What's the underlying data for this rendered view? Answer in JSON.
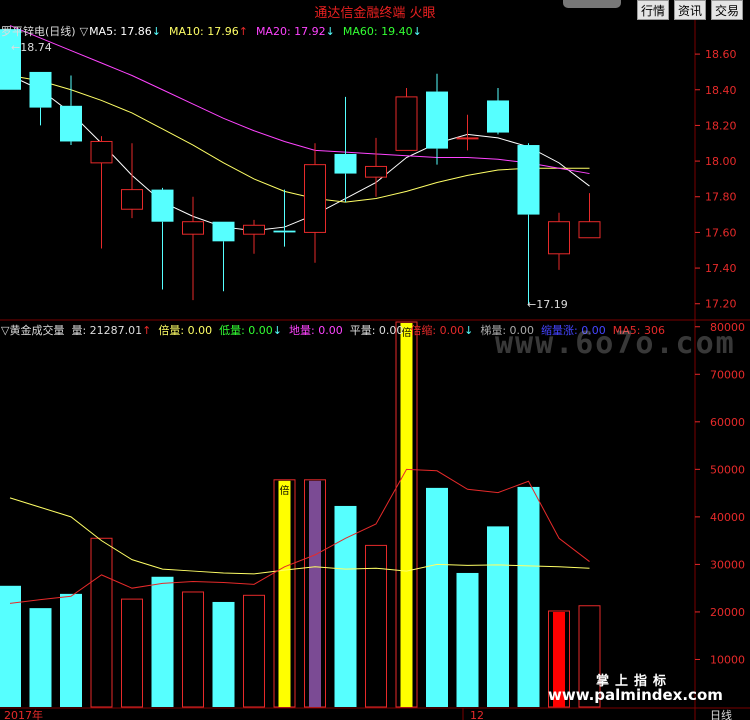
{
  "header": {
    "app_title": "通达信金融终端  火眼",
    "buttons": [
      {
        "label": "行情",
        "left": 637
      },
      {
        "label": "资讯",
        "left": 674
      },
      {
        "label": "交易",
        "left": 711
      }
    ]
  },
  "colors": {
    "up": "#e62a2a",
    "down": "#56ffff",
    "ma5": "#ffffff",
    "ma10": "#ffff66",
    "ma20": "#ff44ff",
    "ma60": "#33ff33",
    "grid": "#7a0000",
    "vol_ma5": "#ffff66",
    "vol_ma10": "#e62a2a",
    "yellow_bar": "#ffff00",
    "purple_bar": "#7b4b94",
    "solid_red": "#ff0000",
    "axis_text": "#e62a2a"
  },
  "price_panel": {
    "stock": "罗平锌电(日线)",
    "marker": "▽",
    "ma_labels": [
      {
        "text": "MA5: 17.86",
        "arrow": "↓",
        "color": "#ffffff"
      },
      {
        "text": "MA10: 17.96",
        "arrow": "↑",
        "color": "#ffff66"
      },
      {
        "text": "MA20: 17.92",
        "arrow": "↓",
        "color": "#ff44ff"
      },
      {
        "text": "MA60: 19.40",
        "arrow": "↓",
        "color": "#33ff33"
      }
    ],
    "high_label": "18.74",
    "low_label": "17.19"
  },
  "volume_panel": {
    "items": [
      {
        "text": "▽黄金成交量",
        "color": "#dddddd"
      },
      {
        "text": "量: 21287.01",
        "arrow": "↑",
        "color": "#dddddd"
      },
      {
        "text": "倍量: 0.00",
        "color": "#ffff66"
      },
      {
        "text": "低量: 0.00",
        "arrow": "↓",
        "color": "#33ff33"
      },
      {
        "text": "地量: 0.00",
        "color": "#ff44ff"
      },
      {
        "text": "平量: 0.00",
        "color": "#dddddd"
      },
      {
        "text": "倍缩: 0.00",
        "arrow": "↓",
        "color": "#e62a2a"
      },
      {
        "text": "梯量: 0.00",
        "color": "#aaaaaa"
      },
      {
        "text": "缩量涨: 0.00",
        "color": "#4444ff"
      },
      {
        "text": "MA5: 306",
        "color": "#e62a2a"
      }
    ],
    "stamps": [
      {
        "text": "倍",
        "bar": 9
      },
      {
        "text": "倍",
        "bar": 13
      }
    ]
  },
  "footer": {
    "year_label": "2017年",
    "month_label": "12",
    "period_label": "日线",
    "brand_cn": "掌上指标",
    "brand_url": "www.palmindex.com",
    "watermark": "www.6o7o.com"
  },
  "chart_data": [
    {
      "type": "candlestick",
      "ylim": [
        17.12,
        18.78
      ],
      "yticks": [
        17.2,
        17.4,
        17.6,
        17.8,
        18.0,
        18.2,
        18.4,
        18.6
      ],
      "candles": [
        {
          "o": 18.74,
          "h": 18.74,
          "l": 18.4,
          "c": 18.4
        },
        {
          "o": 18.5,
          "h": 18.5,
          "l": 18.2,
          "c": 18.3
        },
        {
          "o": 18.31,
          "h": 18.48,
          "l": 18.09,
          "c": 18.11
        },
        {
          "o": 17.99,
          "h": 18.14,
          "l": 17.51,
          "c": 18.11
        },
        {
          "o": 17.73,
          "h": 18.1,
          "l": 17.68,
          "c": 17.84
        },
        {
          "o": 17.84,
          "h": 17.85,
          "l": 17.28,
          "c": 17.66
        },
        {
          "o": 17.59,
          "h": 17.8,
          "l": 17.22,
          "c": 17.66
        },
        {
          "o": 17.66,
          "h": 17.66,
          "l": 17.27,
          "c": 17.55
        },
        {
          "o": 17.59,
          "h": 17.67,
          "l": 17.48,
          "c": 17.64
        },
        {
          "o": 17.61,
          "h": 17.84,
          "l": 17.52,
          "c": 17.6
        },
        {
          "o": 17.6,
          "h": 18.1,
          "l": 17.43,
          "c": 17.98
        },
        {
          "o": 18.04,
          "h": 18.36,
          "l": 17.77,
          "c": 17.93
        },
        {
          "o": 17.91,
          "h": 18.13,
          "l": 17.8,
          "c": 17.97
        },
        {
          "o": 18.06,
          "h": 18.41,
          "l": 18.06,
          "c": 18.36
        },
        {
          "o": 18.39,
          "h": 18.49,
          "l": 17.98,
          "c": 18.07
        },
        {
          "o": 18.13,
          "h": 18.26,
          "l": 18.06,
          "c": 18.13
        },
        {
          "o": 18.34,
          "h": 18.41,
          "l": 18.15,
          "c": 18.16
        },
        {
          "o": 18.09,
          "h": 18.1,
          "l": 17.19,
          "c": 17.7
        },
        {
          "o": 17.48,
          "h": 17.71,
          "l": 17.39,
          "c": 17.66
        },
        {
          "o": 17.57,
          "h": 17.82,
          "l": 17.57,
          "c": 17.66
        }
      ],
      "ma_series": [
        {
          "key": "ma5",
          "values": [
            18.48,
            18.4,
            18.27,
            18.1,
            17.92,
            17.77,
            17.69,
            17.63,
            17.61,
            17.63,
            17.7,
            17.79,
            17.88,
            18.02,
            18.1,
            18.15,
            18.13,
            18.08,
            17.99,
            17.86
          ]
        },
        {
          "key": "ma10",
          "values": [
            18.48,
            18.45,
            18.4,
            18.34,
            18.27,
            18.18,
            18.09,
            17.99,
            17.9,
            17.83,
            17.79,
            17.77,
            17.79,
            17.83,
            17.88,
            17.92,
            17.95,
            17.96,
            17.96,
            17.96
          ]
        },
        {
          "key": "ma20",
          "values": [
            18.76,
            18.69,
            18.62,
            18.55,
            18.48,
            18.4,
            18.32,
            18.24,
            18.17,
            18.11,
            18.06,
            18.05,
            18.04,
            18.03,
            18.02,
            18.02,
            18.01,
            17.99,
            17.96,
            17.93
          ]
        }
      ]
    },
    {
      "type": "bar",
      "ylim": [
        0,
        81000
      ],
      "yticks": [
        10000,
        20000,
        30000,
        40000,
        50000,
        60000,
        70000,
        80000
      ],
      "values": [
        25500,
        20800,
        23800,
        35500,
        22700,
        27400,
        24200,
        22100,
        23500,
        47800,
        47800,
        42300,
        34000,
        81000,
        46100,
        28200,
        38000,
        46300,
        20200,
        21300
      ],
      "styles": [
        "down",
        "down",
        "down",
        "up",
        "up",
        "down",
        "up",
        "down",
        "up",
        "up_yellow",
        "up_purple",
        "down",
        "up",
        "up_yellow",
        "down",
        "down",
        "down",
        "down",
        "up_red",
        "up"
      ],
      "ma_series": [
        {
          "key": "vol_ma5",
          "values": [
            44000,
            42000,
            40000,
            35000,
            31000,
            29000,
            28600,
            28200,
            28000,
            28800,
            29500,
            29000,
            29200,
            28600,
            30000,
            29800,
            29900,
            29700,
            29500,
            29200
          ]
        },
        {
          "key": "vol_ma10",
          "values": [
            21800,
            22600,
            23300,
            27800,
            25000,
            26000,
            26400,
            26200,
            25800,
            29500,
            32000,
            35500,
            38500,
            50000,
            49700,
            45800,
            45100,
            47500,
            35500,
            30600
          ]
        }
      ]
    }
  ]
}
